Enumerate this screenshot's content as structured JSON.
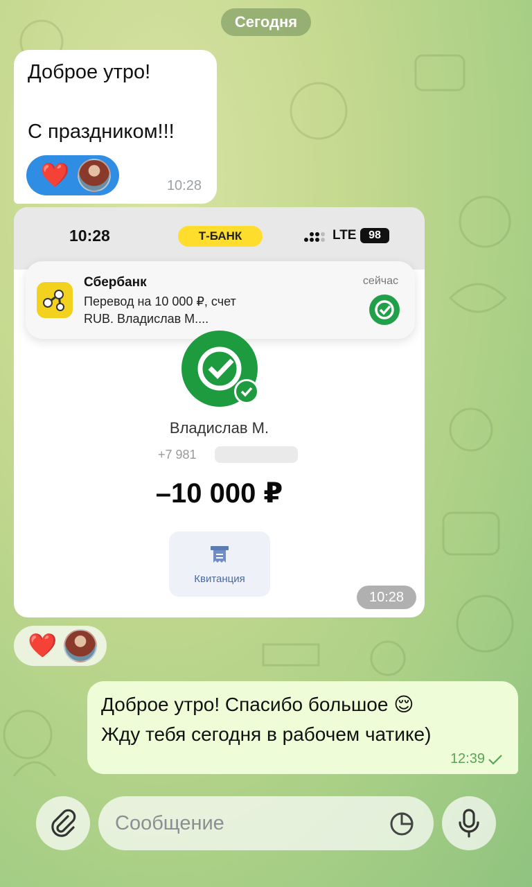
{
  "date_separator": "Сегодня",
  "incoming_message": {
    "line1": "Доброе утро!",
    "line2": "С праздником!!!",
    "time": "10:28",
    "reaction_emoji": "❤️"
  },
  "screenshot": {
    "status_time": "10:28",
    "bank_badge": "Т-БАНК",
    "network": "LTE",
    "battery": "98",
    "notification": {
      "app": "Сбербанк",
      "text_line1": "Перевод на 10 000 ₽, счет",
      "text_line2": "RUB. Владислав М....",
      "time": "сейчас"
    },
    "recipient_name": "Владислав М.",
    "recipient_phone": "+7 981",
    "amount": "–10 000 ₽",
    "receipt_label": "Квитанция",
    "message_time": "10:28"
  },
  "outgoing_message": {
    "line1": "Доброе утро! Спасибо большое 😌",
    "line2": "Жду тебя сегодня в рабочем чатике)",
    "time": "12:39"
  },
  "composer": {
    "placeholder": "Сообщение"
  },
  "colors": {
    "accent_blue": "#2f8de4",
    "outgoing_bubble": "#eefdd7",
    "sber_green": "#1f9b3f",
    "tbank_yellow": "#ffdd2d"
  }
}
